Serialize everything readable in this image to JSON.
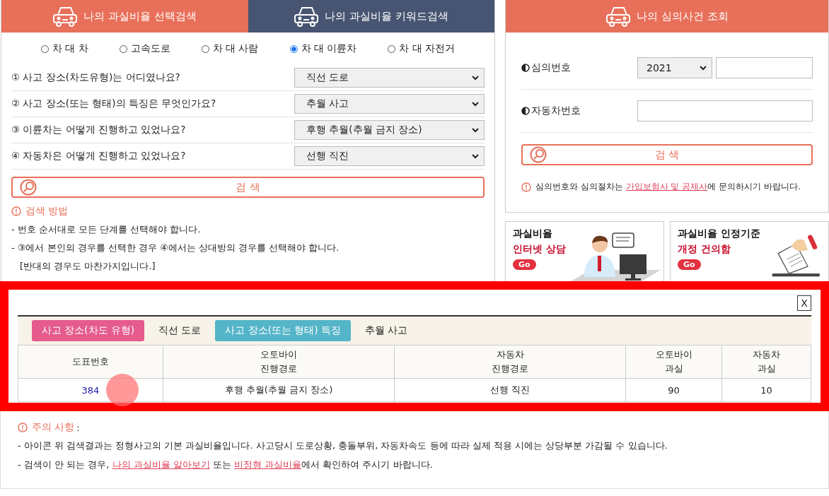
{
  "tabs": [
    {
      "label": "나의 과실비율 선택검색",
      "selected": true
    },
    {
      "label": "나의 과실비율 키워드검색",
      "selected": false
    }
  ],
  "accident_types": [
    {
      "label": "차 대 차",
      "selected": false
    },
    {
      "label": "고속도로",
      "selected": false
    },
    {
      "label": "차 대 사람",
      "selected": false
    },
    {
      "label": "차 대 이륜차",
      "selected": true
    },
    {
      "label": "차 대 자전거",
      "selected": false
    }
  ],
  "questions": [
    {
      "label": "① 사고 장소(차도유형)는 어디였나요?",
      "value": "직선 도로"
    },
    {
      "label": "② 사고 장소(또는 형태)의 특징은 무엇인가요?",
      "value": "추월 사고"
    },
    {
      "label": "③ 이륜차는 어떻게 진행하고 있었나요?",
      "value": "후행 추월(추월 금지 장소)"
    },
    {
      "label": "④ 자동차은 어떻게 진행하고 있었나요?",
      "value": "선행 직진"
    }
  ],
  "search_button": "검 색",
  "help": {
    "title": "검색 방법",
    "lines": [
      "- 번호 순서대로 모든 단계를 선택해야 합니다.",
      "- ③에서 본인의 경우를 선택한 경우 ④에서는 상대방의 경우를 선택해야 합니다.",
      "[반대의 경우도 마찬가지입니다.]"
    ]
  },
  "case_lookup": {
    "title": "나의 심의사건 조회",
    "fields": [
      {
        "label": "심의번호",
        "year": "2021"
      },
      {
        "label": "자동차번호"
      }
    ],
    "search_button": "검 색",
    "notice": [
      {
        "kind": "text",
        "text": "심의번호와 심의절차는 "
      },
      {
        "kind": "link",
        "text": "가입보험사 및 공제사"
      },
      {
        "kind": "text",
        "text": "에 문의하시기 바랍니다."
      }
    ]
  },
  "promos": [
    {
      "title": "과실비율",
      "subtitle": "인터넷 상담",
      "go": "Go",
      "kind": "consult"
    },
    {
      "title": "과실비율 인정기준",
      "subtitle": "개정 건의함",
      "go": "Go",
      "kind": "proposal"
    }
  ],
  "result": {
    "close": "X",
    "tags": [
      {
        "label": "사고 장소(차도 유형)",
        "value": "직선 도로",
        "color": "#e45b8c"
      },
      {
        "label": "사고 장소(또는 형태) 특징",
        "value": "추월 사고",
        "color": "#55b5c8"
      }
    ],
    "columns": [
      {
        "lines": [
          "도표번호"
        ]
      },
      {
        "lines": [
          "오토바이",
          "진행경로"
        ]
      },
      {
        "lines": [
          "자동차",
          "진행경로"
        ]
      },
      {
        "lines": [
          "오토바이",
          "과실"
        ]
      },
      {
        "lines": [
          "자동차",
          "과실"
        ]
      }
    ],
    "rows": [
      {
        "cells": [
          "384",
          "후행 추월(추월 금지 장소)",
          "선행 직진",
          "90",
          "10"
        ]
      }
    ]
  },
  "notes": {
    "title": "주의 사항",
    "title_suffix": ":",
    "lines": [
      [
        {
          "kind": "text",
          "text": "- 아이콘 위 검색결과는 정형사고의 기본 과실비율입니다. 사고당시 도로상황, 충돌부위, 자동차속도 등에 따라 실제 적용 시에는 상당부분 가감될 수 있습니다."
        }
      ],
      [
        {
          "kind": "text",
          "text": "- 검색이 안 되는 경우, "
        },
        {
          "kind": "link",
          "text": "나의 과실비율 알아보기"
        },
        {
          "kind": "text",
          "text": " 또는 "
        },
        {
          "kind": "link",
          "text": "비정형 과실비율"
        },
        {
          "kind": "text",
          "text": "에서 확인하여 주시기 바랍니다."
        }
      ]
    ]
  }
}
